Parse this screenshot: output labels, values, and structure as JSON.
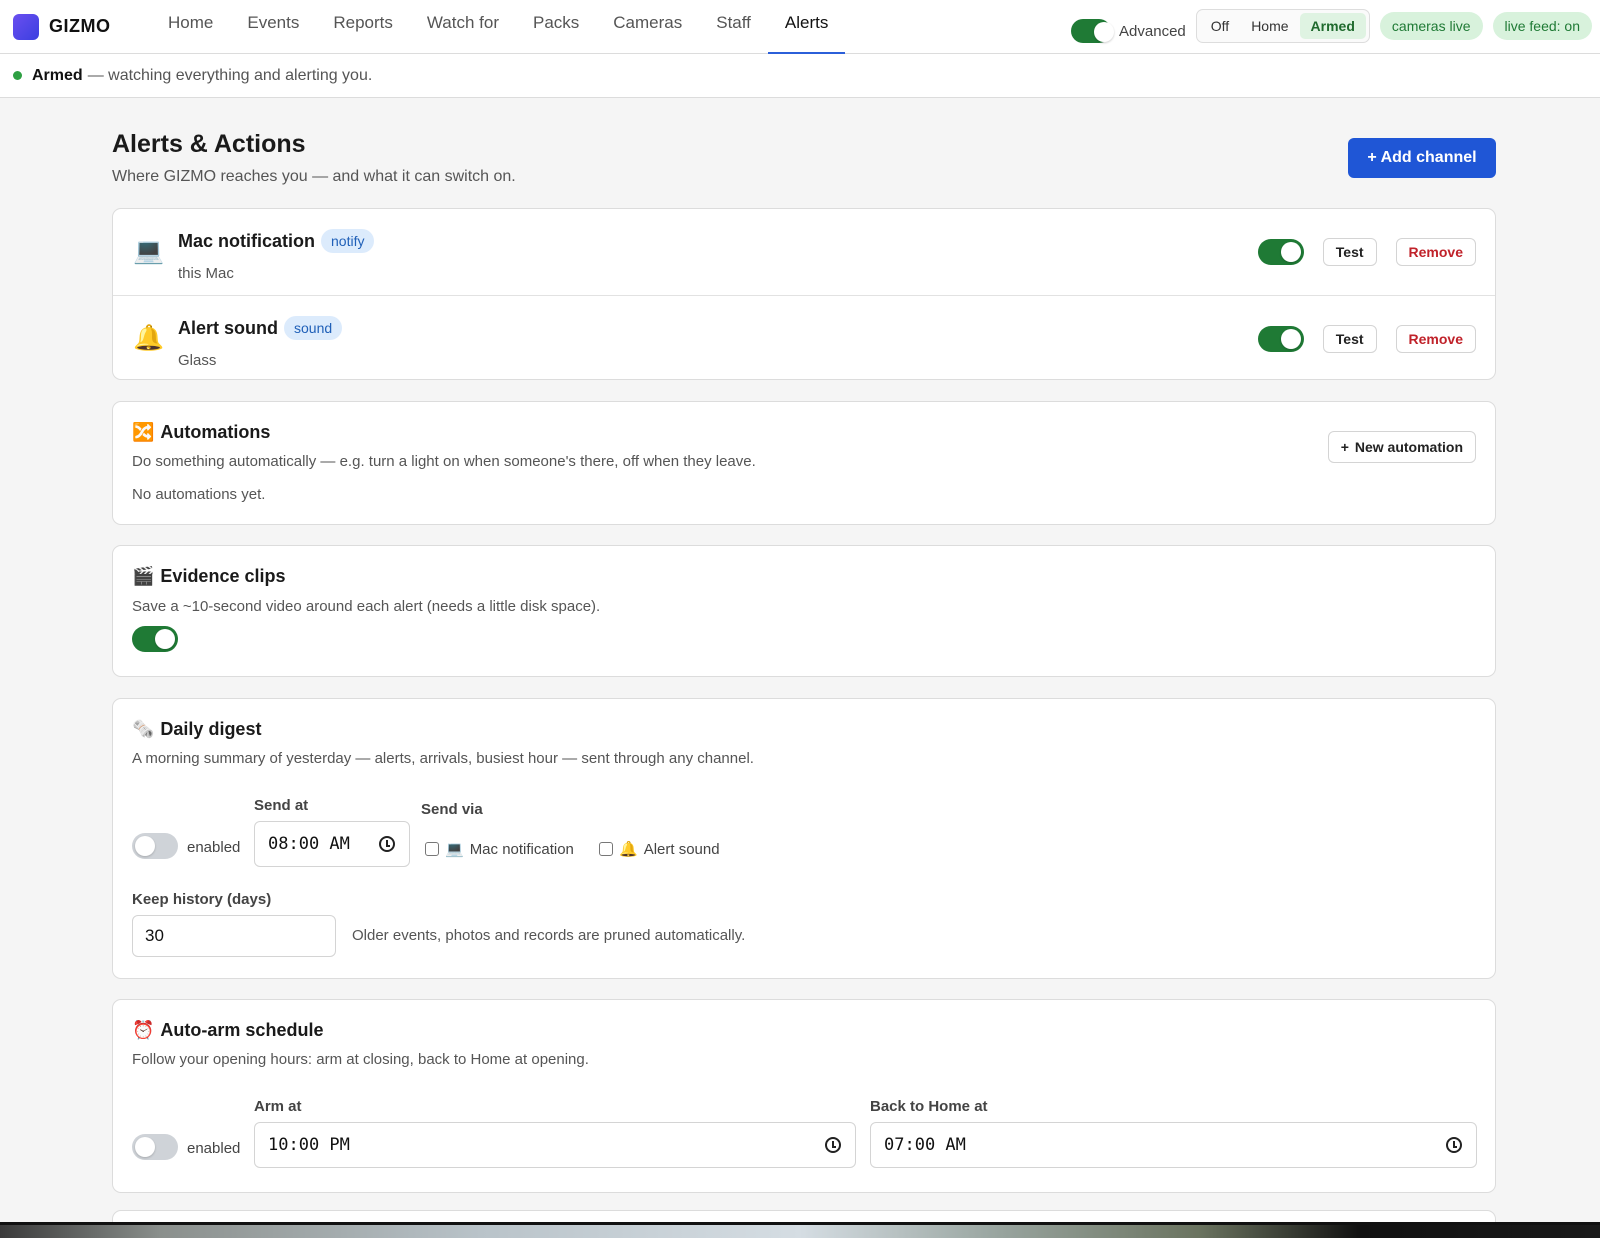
{
  "app": {
    "name": "GIZMO"
  },
  "nav": {
    "tabs": [
      {
        "label": "Home"
      },
      {
        "label": "Events"
      },
      {
        "label": "Reports"
      },
      {
        "label": "Watch for"
      },
      {
        "label": "Packs"
      },
      {
        "label": "Cameras"
      },
      {
        "label": "Staff"
      },
      {
        "label": "Alerts"
      }
    ],
    "active": "Alerts"
  },
  "topbar": {
    "advanced_label": "Advanced",
    "advanced_on": true,
    "modes": [
      "Off",
      "Home",
      "Armed"
    ],
    "active_mode": "Armed",
    "cameras_badge": "cameras live",
    "feed_badge": "live feed: on"
  },
  "status": {
    "state": "Armed",
    "message": "— watching everything and alerting you."
  },
  "page": {
    "title": "Alerts & Actions",
    "subtitle": "Where GIZMO reaches you — and what it can switch on.",
    "add_channel": "+ Add channel"
  },
  "channels": [
    {
      "icon": "💻",
      "name": "Mac notification",
      "tag": "notify",
      "detail": "this Mac",
      "enabled": true,
      "test": "Test",
      "remove": "Remove"
    },
    {
      "icon": "🔔",
      "name": "Alert sound",
      "tag": "sound",
      "detail": "Glass",
      "enabled": true,
      "test": "Test",
      "remove": "Remove"
    }
  ],
  "automations": {
    "icon": "🔀",
    "title": "Automations",
    "desc": "Do something automatically — e.g. turn a light on when someone's there, off when they leave.",
    "empty": "No automations yet.",
    "new_button": "New automation"
  },
  "evidence": {
    "icon": "🎬",
    "title": "Evidence clips",
    "desc": "Save a ~10-second video around each alert (needs a little disk space).",
    "enabled": true
  },
  "digest": {
    "icon": "🗞️",
    "title": "Daily digest",
    "desc": "A morning summary of yesterday — alerts, arrivals, busiest hour — sent through any channel.",
    "enabled_label": "enabled",
    "enabled": false,
    "send_at_label": "Send at",
    "send_at": "08:00 AM",
    "send_via_label": "Send via",
    "via": [
      {
        "icon": "💻",
        "label": "Mac notification",
        "checked": false
      },
      {
        "icon": "🔔",
        "label": "Alert sound",
        "checked": false
      }
    ],
    "history_label": "Keep history (days)",
    "history_days": "30",
    "history_note": "Older events, photos and records are pruned automatically."
  },
  "schedule": {
    "icon": "⏰",
    "title": "Auto-arm schedule",
    "desc": "Follow your opening hours: arm at closing, back to Home at opening.",
    "enabled_label": "enabled",
    "enabled": false,
    "arm_label": "Arm at",
    "arm_at": "10:00 PM",
    "home_label": "Back to Home at",
    "home_at": "07:00 AM"
  }
}
